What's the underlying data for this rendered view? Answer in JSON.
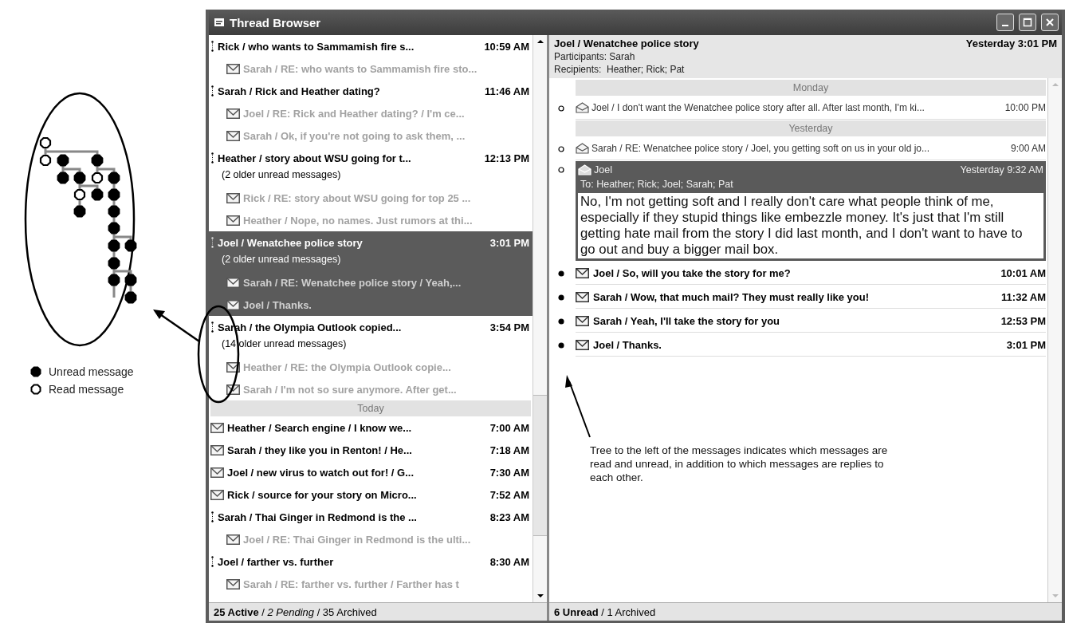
{
  "window": {
    "title": "Thread Browser"
  },
  "thread_list": {
    "items": [
      {
        "kind": "thread",
        "text": "Rick / who wants to Sammamish fire s...",
        "time": "10:59 AM",
        "selected": false
      },
      {
        "kind": "reply",
        "text": "Sarah / RE: who wants to Sammamish fire sto...",
        "unread": false,
        "selected": false
      },
      {
        "kind": "thread",
        "text": "Sarah / Rick and Heather dating?",
        "time": "11:46 AM",
        "selected": false
      },
      {
        "kind": "reply",
        "text": "Joel / RE: Rick and Heather dating? / I'm ce...",
        "unread": false,
        "selected": false
      },
      {
        "kind": "reply",
        "text": "Sarah / Ok, if you're not going to ask them, ...",
        "unread": false,
        "selected": false
      },
      {
        "kind": "thread",
        "text": "Heather / story about WSU going for t...",
        "time": "12:13 PM",
        "selected": false
      },
      {
        "kind": "note",
        "text": "(2 older unread messages)",
        "selected": false
      },
      {
        "kind": "reply",
        "text": "Rick / RE: story about WSU going for top 25 ...",
        "unread": false,
        "selected": false
      },
      {
        "kind": "reply",
        "text": "Heather / Nope, no names. Just rumors at thi...",
        "unread": false,
        "selected": false
      },
      {
        "kind": "thread",
        "text": "Joel / Wenatchee police story",
        "time": "3:01 PM",
        "selected": true
      },
      {
        "kind": "note",
        "text": "(2 older unread messages)",
        "selected": true
      },
      {
        "kind": "reply",
        "text": "Sarah / RE: Wenatchee police story / Yeah,...",
        "unread": false,
        "selected": true
      },
      {
        "kind": "reply",
        "text": "Joel / Thanks.",
        "unread": false,
        "selected": true
      },
      {
        "kind": "thread",
        "text": "Sarah / the Olympia Outlook copied...",
        "time": "3:54 PM",
        "selected": false
      },
      {
        "kind": "note",
        "text": "(14 older unread messages)",
        "selected": false
      },
      {
        "kind": "reply",
        "text": "Heather / RE: the Olympia Outlook copie...",
        "unread": false,
        "selected": false
      },
      {
        "kind": "reply",
        "text": "Sarah / I'm not so sure anymore. After get...",
        "unread": false,
        "selected": false
      },
      {
        "kind": "separator",
        "text": "Today"
      },
      {
        "kind": "message",
        "text": "Heather / Search engine / I know we...",
        "time": "7:00 AM",
        "unread": true,
        "selected": false
      },
      {
        "kind": "message",
        "text": "Sarah / they like you in Renton! / He...",
        "time": "7:18 AM",
        "unread": true,
        "selected": false
      },
      {
        "kind": "message",
        "text": "Joel / new virus to watch out for! / G...",
        "time": "7:30 AM",
        "unread": true,
        "selected": false
      },
      {
        "kind": "message",
        "text": "Rick / source for your story on Micro...",
        "time": "7:52 AM",
        "unread": true,
        "selected": false
      },
      {
        "kind": "thread",
        "text": "Sarah / Thai Ginger in Redmond is the ...",
        "time": "8:23 AM",
        "selected": false
      },
      {
        "kind": "reply",
        "text": "Joel / RE: Thai Ginger in Redmond is the ulti...",
        "unread": false,
        "selected": false
      },
      {
        "kind": "thread",
        "text": "Joel / farther vs. further",
        "time": "8:30 AM",
        "selected": false
      },
      {
        "kind": "reply",
        "text": "Sarah / RE: farther vs. further / Farther has t",
        "unread": false,
        "selected": false
      }
    ]
  },
  "left_status": "**25 Active** / *2 Pending* / 35 Archived",
  "thread_header": {
    "title": "Joel / Wenatchee police story",
    "date": "Yesterday 3:01 PM",
    "participants": "Participants: Sarah",
    "recipients": "Recipients:  Heather; Rick; Pat"
  },
  "conversation": [
    {
      "kind": "separator",
      "text": "Monday"
    },
    {
      "kind": "message",
      "text": "Joel / I don't want the Wenatchee police story after all. After last month, I'm ki...",
      "time": "10:00 PM",
      "unread": false
    },
    {
      "kind": "separator",
      "text": "Yesterday"
    },
    {
      "kind": "message",
      "text": "Sarah / RE: Wenatchee police story / Joel, you getting soft on us in your old jo...",
      "time": "9:00 AM",
      "unread": false
    },
    {
      "kind": "expanded",
      "sender": "Joel",
      "time": "Yesterday 9:32 AM",
      "to": "To: Heather; Rick; Joel; Sarah; Pat",
      "body": "No, I'm not getting soft and I really don't care what people think of me, especially if they stupid things like embezzle money.  It's just that I'm still getting hate mail from the story I did last month, and I don't want to have to go out and buy a bigger mail box.",
      "unread": false
    },
    {
      "kind": "message",
      "text": "Joel / So, will you take the story for me?",
      "time": "10:01 AM",
      "unread": true
    },
    {
      "kind": "message",
      "text": "Sarah / Wow, that much mail? They must really like you!",
      "time": "11:32 AM",
      "unread": true
    },
    {
      "kind": "message",
      "text": "Sarah / Yeah, I'll take the story for you",
      "time": "12:53 PM",
      "unread": true
    },
    {
      "kind": "message",
      "text": "Joel / Thanks.",
      "time": "3:01 PM",
      "unread": true
    }
  ],
  "right_status": "**6 Unread** / 1 Archived",
  "legend": [
    {
      "kind": "unread",
      "label": "Unread message"
    },
    {
      "kind": "read",
      "label": "Read message"
    }
  ],
  "callout": "Tree to the left of the messages indicates which messages are read and unread, in addition to which messages are replies to each other."
}
